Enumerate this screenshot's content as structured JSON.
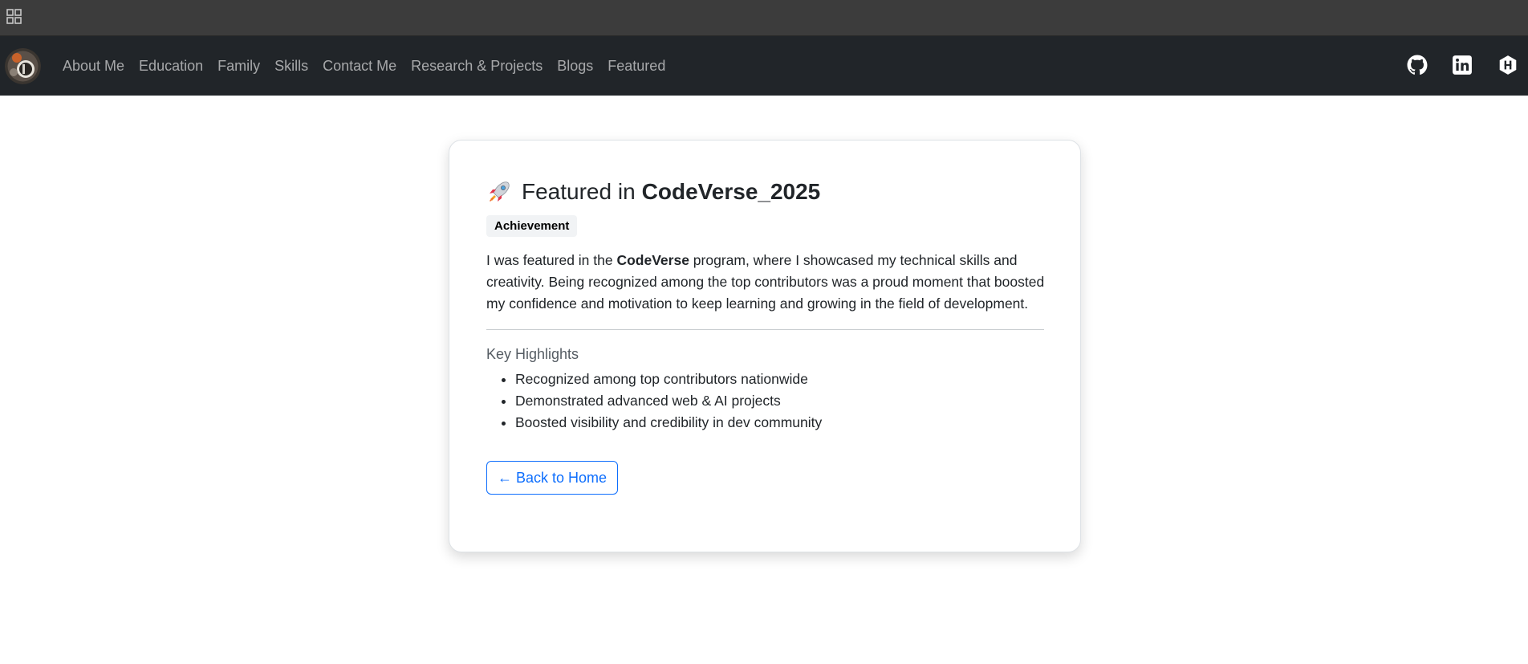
{
  "nav": {
    "links": [
      {
        "label": "About Me"
      },
      {
        "label": "Education"
      },
      {
        "label": "Family"
      },
      {
        "label": "Skills"
      },
      {
        "label": "Contact Me"
      },
      {
        "label": "Research & Projects"
      },
      {
        "label": "Blogs"
      },
      {
        "label": "Featured"
      }
    ],
    "social_icons": [
      "github-icon",
      "linkedin-icon",
      "hashnode-icon"
    ]
  },
  "card": {
    "title_prefix": "Featured in",
    "title_strong": "CodeVerse_2025",
    "badge": "Achievement",
    "description_before": "I was featured in the ",
    "description_strong": "CodeVerse",
    "description_after": " program, where I showcased my technical skills and creativity. Being recognized among the top contributors was a proud moment that boosted my confidence and motivation to keep learning and growing in the field of development.",
    "highlights_title": "Key Highlights",
    "highlights": [
      "Recognized among top contributors nationwide",
      "Demonstrated advanced web & AI projects",
      "Boosted visibility and credibility in dev community"
    ],
    "back_button": "← Back to Home"
  },
  "colors": {
    "navbar_bg": "#212529",
    "chrome_bg": "#3c3c3c",
    "accent": "#0d6efd"
  }
}
